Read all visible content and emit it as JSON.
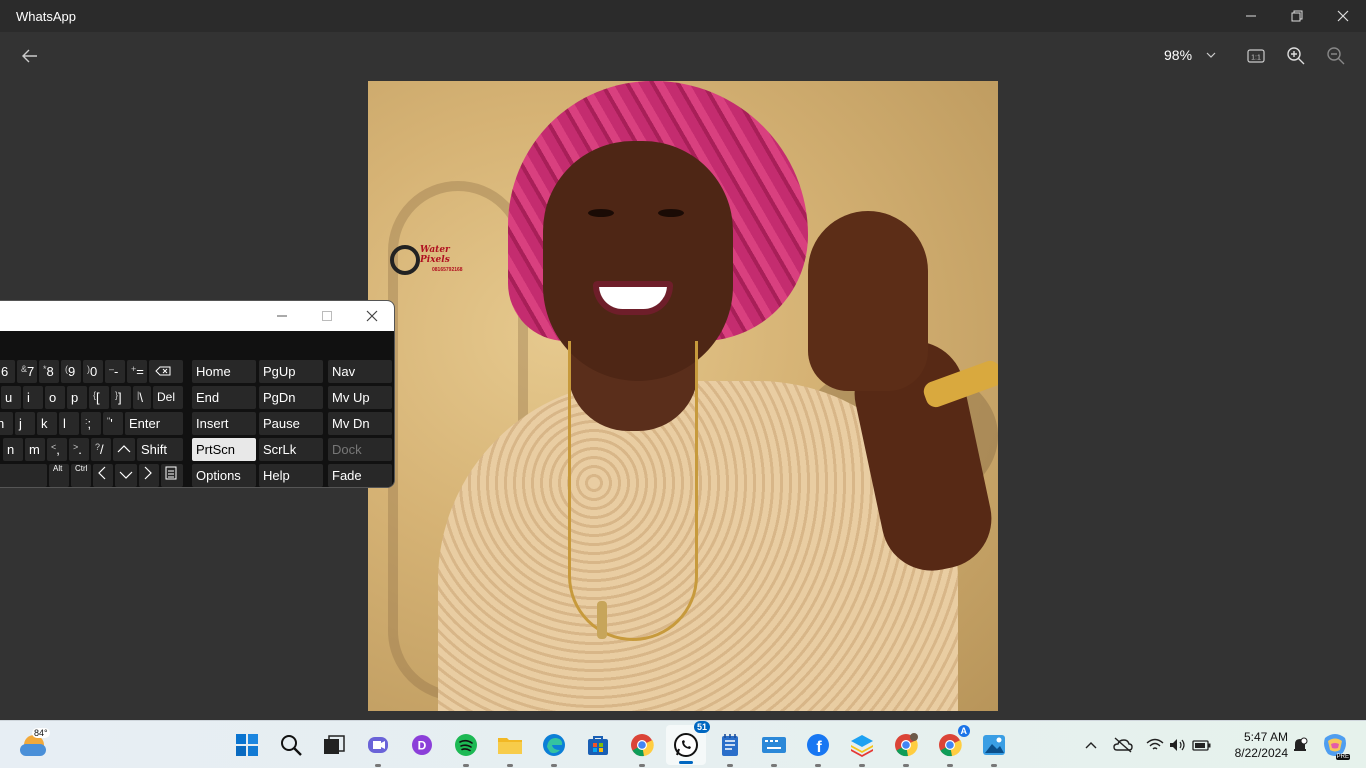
{
  "window": {
    "title": "WhatsApp"
  },
  "toolbar": {
    "zoom": "98%",
    "actual_size_label": "1:1"
  },
  "photo": {
    "logo_text": "Water Pixels",
    "logo_phone": "08165792168"
  },
  "osk": {
    "row1": [
      {
        "main": "6",
        "sup": ""
      },
      {
        "main": "7",
        "sup": "&"
      },
      {
        "main": "8",
        "sup": "*"
      },
      {
        "main": "9",
        "sup": "("
      },
      {
        "main": "0",
        "sup": ")"
      },
      {
        "main": "-",
        "sup": "–"
      },
      {
        "main": "=",
        "sup": "+"
      }
    ],
    "row2": [
      "u",
      "i",
      "o",
      "p"
    ],
    "row2_brackets": [
      {
        "main": "[",
        "sup": "{"
      },
      {
        "main": "]",
        "sup": "}"
      },
      {
        "main": "\\",
        "sup": "|"
      }
    ],
    "del": "Del",
    "row3": [
      "h",
      "j",
      "k",
      "l"
    ],
    "row3_punct": [
      {
        "main": ";",
        "sup": ":"
      },
      {
        "main": "'",
        "sup": "\""
      }
    ],
    "enter": "Enter",
    "row4": [
      "n",
      "m"
    ],
    "row4_punct": [
      {
        "main": ",",
        "sup": "<"
      },
      {
        "main": ".",
        "sup": ">"
      },
      {
        "main": "/",
        "sup": "?"
      }
    ],
    "shift": "Shift",
    "alt": "Alt",
    "ctrl": "Ctrl",
    "nav_keys": {
      "home": "Home",
      "pgup": "PgUp",
      "nav": "Nav",
      "end": "End",
      "pgdn": "PgDn",
      "mvup": "Mv Up",
      "insert": "Insert",
      "pause": "Pause",
      "mvdn": "Mv Dn",
      "prtscn": "PrtScn",
      "scrlk": "ScrLk",
      "dock": "Dock",
      "options": "Options",
      "help": "Help",
      "fade": "Fade"
    }
  },
  "taskbar": {
    "weather_temp": "84°",
    "whatsapp_badge": "51",
    "chrome_profile_badge": "A",
    "time": "5:47 AM",
    "date": "8/22/2024",
    "copilot_badge": "PRE"
  }
}
